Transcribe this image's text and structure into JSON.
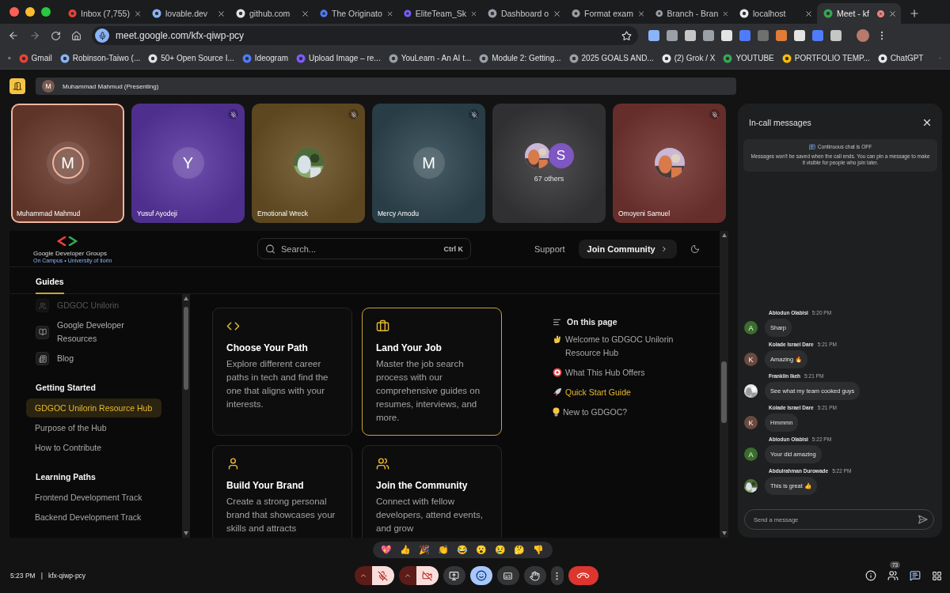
{
  "browser": {
    "tabs": [
      {
        "title": "Inbox (7,755)",
        "selected": false,
        "recording": false
      },
      {
        "title": "lovable.dev",
        "selected": false,
        "recording": false
      },
      {
        "title": "github.com",
        "selected": false,
        "recording": false
      },
      {
        "title": "The Originato",
        "selected": false,
        "recording": false
      },
      {
        "title": "EliteTeam_Sk",
        "selected": false,
        "recording": false
      },
      {
        "title": "Dashboard o",
        "selected": false,
        "recording": false
      },
      {
        "title": "Format exam",
        "selected": false,
        "recording": false
      },
      {
        "title": "Branch - Bran",
        "selected": false,
        "recording": false
      },
      {
        "title": "localhost",
        "selected": false,
        "recording": false
      },
      {
        "title": "Meet - kf",
        "selected": true,
        "recording": true
      }
    ],
    "url": "meet.google.com/kfx-qiwp-pcy",
    "bookmarks": [
      "Gmail",
      "Robinson-Taiwo (...",
      "50+ Open Source I...",
      "Ideogram",
      "Upload Image – re...",
      "YouLearn - An AI t...",
      "Module 2: Getting...",
      "2025 GOALS AND...",
      "(2) Grok / X",
      "YOUTUBE",
      "PORTFOLIO TEMP...",
      "ChatGPT"
    ]
  },
  "presenting": {
    "initial": "M",
    "label": "Muhammad Mahmud (Presenting)"
  },
  "tiles": [
    {
      "kind": "initial",
      "name": "Muhammad Mahmud",
      "initial": "M",
      "color": "#6b3b2d",
      "muted": false,
      "selected": true
    },
    {
      "kind": "initial",
      "name": "Yusuf Ayodeji",
      "initial": "Y",
      "color": "#5a36a0",
      "muted": true,
      "selected": false
    },
    {
      "name": "Emotional Wreck",
      "color": "#6a5126",
      "muted": true,
      "selected": false
    },
    {
      "kind": "initial",
      "name": "Mercy Amodu",
      "initial": "M",
      "color": "#2d4650",
      "muted": true,
      "selected": false
    },
    {
      "kind": "others",
      "label": "67 others",
      "initial": "S",
      "color": "#37373a",
      "muted": false,
      "selected": false
    },
    {
      "name": "Omoyeni Samuel",
      "color": "#733430",
      "muted": true,
      "selected": false
    }
  ],
  "site": {
    "logo_title": "Google Developer Groups",
    "logo_subtitle": "On Campus • University of Ilorin",
    "search": {
      "placeholder": "Search...",
      "shortcut": "Ctrl K"
    },
    "nav": [
      {
        "kind": "link",
        "label": "Support"
      },
      {
        "kind": "button",
        "label": "Join Community"
      }
    ],
    "tab": {
      "label": "Guides",
      "selected": true
    },
    "pages": [
      {
        "label": "GDGOC Unilorin",
        "faded": true
      },
      {
        "label": "Google Developer Resources",
        "faded": false
      },
      {
        "label": "Blog",
        "faded": false
      }
    ],
    "sections": [
      {
        "title": "Getting Started",
        "items": [
          {
            "label": "GDGOC Unilorin Resource Hub",
            "selected": true
          },
          {
            "label": "Purpose of the Hub",
            "selected": false
          },
          {
            "label": "How to Contribute",
            "selected": false
          }
        ]
      },
      {
        "title": "Learning Paths",
        "items": [
          {
            "label": "Frontend Development Track",
            "selected": false
          },
          {
            "label": "Backend Development Track",
            "selected": false
          }
        ]
      }
    ],
    "cards": [
      {
        "kind": "code",
        "title": "Choose Your Path",
        "description": "Explore different career paths in tech and find the one that aligns with your interests.",
        "selected": false
      },
      {
        "kind": "briefcase",
        "title": "Land Your Job",
        "description": "Master the job search process with our comprehensive guides on resumes, interviews, and more.",
        "selected": true
      },
      {
        "kind": "person",
        "title": "Build Your Brand",
        "description": "Create a strong personal brand that showcases your skills and attracts",
        "selected": false
      },
      {
        "kind": "people",
        "title": "Join the Community",
        "description": "Connect with fellow developers, attend events, and grow",
        "selected": false
      }
    ],
    "toc": {
      "title": "On this page",
      "items": [
        {
          "label": "Welcome to GDGOC Unilorin Resource Hub",
          "selected": false
        },
        {
          "label": "What This Hub Offers",
          "selected": false
        },
        {
          "label": "Quick Start Guide",
          "selected": true
        },
        {
          "label": "New to GDGOC?",
          "selected": false
        }
      ]
    }
  },
  "chat": {
    "title": "In-call messages",
    "notice_title": "Continuous chat is OFF",
    "notice_body": "Messages won't be saved when the call ends. You can pin a message to make it visible for people who join later.",
    "messages": [
      {
        "sender": "Abiodun Olabisi",
        "time": "5:20 PM",
        "text": "Sharp",
        "avatar": {
          "kind": "initial",
          "initial": "A",
          "color": "#3b6d2c"
        }
      },
      {
        "sender": "Kolade Israel Dare",
        "time": "5:21 PM",
        "text": "Amazing 🔥",
        "avatar": {
          "kind": "initial",
          "initial": "K",
          "color": "#6a4a40"
        }
      },
      {
        "sender": "Franklin Ikeh",
        "time": "5:21 PM",
        "text": "See what my team cooked guys"
      },
      {
        "sender": "Kolade Israel Dare",
        "time": "5:21 PM",
        "text": "Hmmmn",
        "avatar": {
          "kind": "initial",
          "initial": "K",
          "color": "#6a4a40"
        }
      },
      {
        "sender": "Abiodun Olabisi",
        "time": "5:22 PM",
        "text": "Your did amazing",
        "avatar": {
          "kind": "initial",
          "initial": "A",
          "color": "#3b6d2c"
        }
      },
      {
        "sender": "Abdulrahman Durowade",
        "time": "5:22 PM",
        "text": "This is great 👍"
      }
    ],
    "placeholder": "Send a message"
  },
  "bottom": {
    "time": "5:23 PM",
    "separator": "|",
    "meeting_code": "kfx-qiwp-pcy",
    "reactions": [
      "💖",
      "👍",
      "🎉",
      "👏",
      "😂",
      "😮",
      "😢",
      "🤔",
      "👎"
    ],
    "mic": {
      "on": false
    },
    "camera": {
      "on": false
    },
    "buttons": [
      {
        "kind": "present",
        "selected": false
      },
      {
        "kind": "reactions",
        "selected": true
      },
      {
        "kind": "captions",
        "selected": false
      },
      {
        "kind": "hand",
        "selected": false
      },
      {
        "kind": "more",
        "selected": false
      },
      {
        "kind": "leave",
        "selected": false
      }
    ],
    "side": [
      {
        "kind": "info",
        "selected": false
      },
      {
        "kind": "people",
        "badge": "73",
        "selected": false
      },
      {
        "kind": "chat",
        "selected": true
      },
      {
        "kind": "activities",
        "selected": false
      }
    ]
  }
}
